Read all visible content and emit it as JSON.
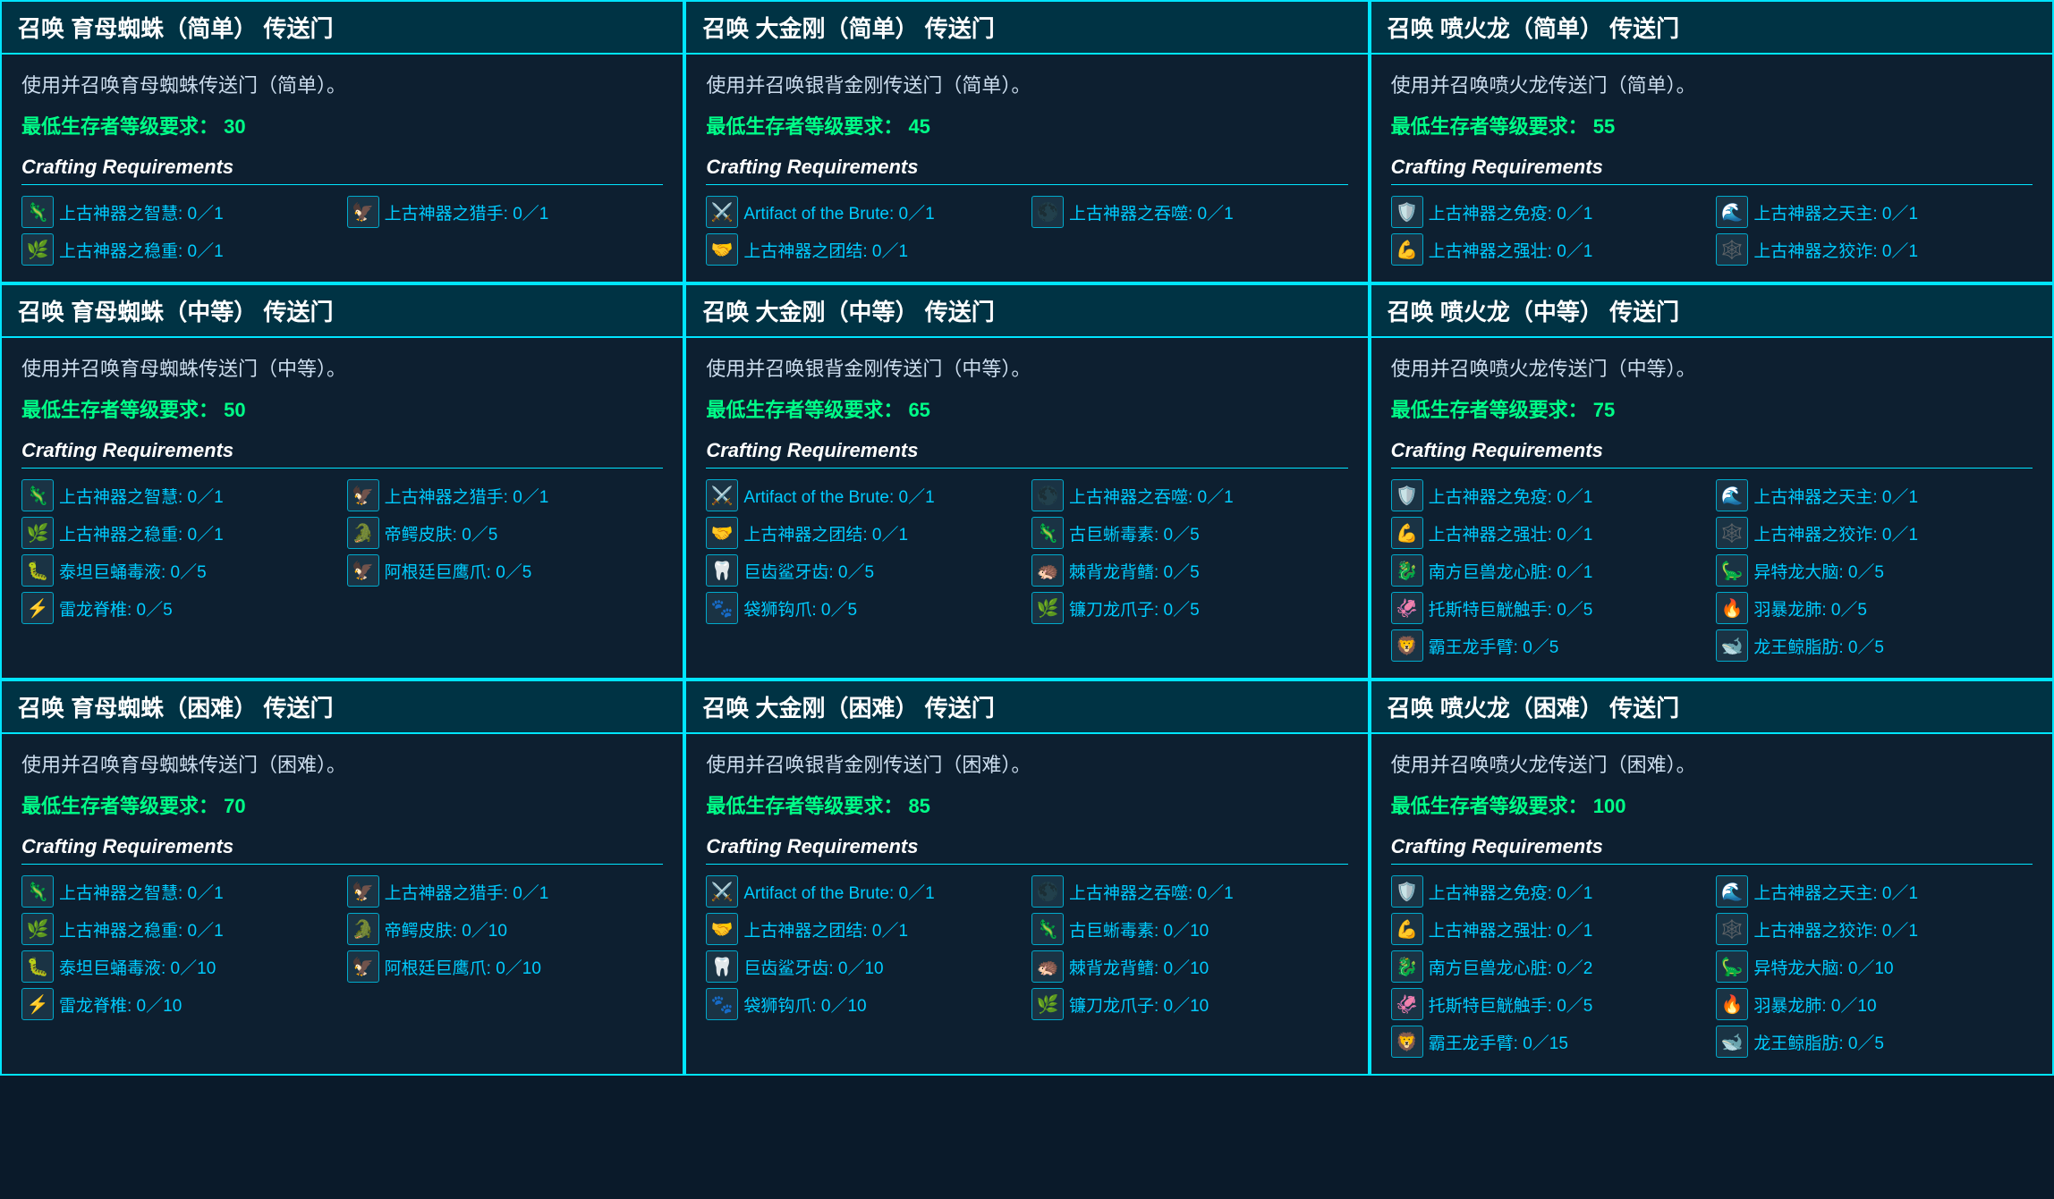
{
  "cards": [
    {
      "id": "spider-easy",
      "header": "召唤 育母蜘蛛（简单） 传送门",
      "description": "使用并召唤育母蜘蛛传送门（简单）。",
      "level_label": "最低生存者等级要求：",
      "level_value": "30",
      "crafting_title": "Crafting Requirements",
      "requirements": [
        {
          "icon": "🦎",
          "icon_class": "icon-green",
          "text": "上古神器之智慧: 0／1"
        },
        {
          "icon": "🦅",
          "icon_class": "icon-gray",
          "text": "上古神器之猎手: 0／1"
        },
        {
          "icon": "🌿",
          "icon_class": "icon-green",
          "text": "上古神器之稳重: 0／1"
        }
      ]
    },
    {
      "id": "gorilla-easy",
      "header": "召唤 大金刚（简单） 传送门",
      "description": "使用并召唤银背金刚传送门（简单）。",
      "level_label": "最低生存者等级要求：",
      "level_value": "45",
      "crafting_title": "Crafting Requirements",
      "requirements": [
        {
          "icon": "⚔️",
          "icon_class": "icon-orange",
          "text": "Artifact of the Brute: 0／1"
        },
        {
          "icon": "🌑",
          "icon_class": "icon-purple",
          "text": "上古神器之吞噬: 0／1"
        },
        {
          "icon": "🤝",
          "icon_class": "icon-cyan",
          "text": "上古神器之团结: 0／1"
        }
      ]
    },
    {
      "id": "dragon-easy",
      "header": "召唤 喷火龙（简单） 传送门",
      "description": "使用并召唤喷火龙传送门（简单）。",
      "level_label": "最低生存者等级要求：",
      "level_value": "55",
      "crafting_title": "Crafting Requirements",
      "requirements": [
        {
          "icon": "🛡️",
          "icon_class": "icon-red",
          "text": "上古神器之免疫: 0／1"
        },
        {
          "icon": "🌊",
          "icon_class": "icon-blue",
          "text": "上古神器之天主: 0／1"
        },
        {
          "icon": "💪",
          "icon_class": "icon-yellow",
          "text": "上古神器之强壮: 0／1"
        },
        {
          "icon": "🕸️",
          "icon_class": "icon-purple",
          "text": "上古神器之狡诈: 0／1"
        }
      ]
    },
    {
      "id": "spider-medium",
      "header": "召唤 育母蜘蛛（中等） 传送门",
      "description": "使用并召唤育母蜘蛛传送门（中等）。",
      "level_label": "最低生存者等级要求：",
      "level_value": "50",
      "crafting_title": "Crafting Requirements",
      "requirements": [
        {
          "icon": "🦎",
          "icon_class": "icon-green",
          "text": "上古神器之智慧: 0／1"
        },
        {
          "icon": "🦅",
          "icon_class": "icon-gray",
          "text": "上古神器之猎手: 0／1"
        },
        {
          "icon": "🌿",
          "icon_class": "icon-green",
          "text": "上古神器之稳重: 0／1"
        },
        {
          "icon": "🐊",
          "icon_class": "icon-green",
          "text": "帝鳄皮肤: 0／5"
        },
        {
          "icon": "🐛",
          "icon_class": "icon-yellow",
          "text": "泰坦巨蛹毒液: 0／5"
        },
        {
          "icon": "🦅",
          "icon_class": "icon-cyan",
          "text": "阿根廷巨鹰爪: 0／5"
        },
        {
          "icon": "⚡",
          "icon_class": "icon-blue",
          "text": "雷龙脊椎: 0／5"
        }
      ]
    },
    {
      "id": "gorilla-medium",
      "header": "召唤 大金刚（中等） 传送门",
      "description": "使用并召唤银背金刚传送门（中等）。",
      "level_label": "最低生存者等级要求：",
      "level_value": "65",
      "crafting_title": "Crafting Requirements",
      "requirements": [
        {
          "icon": "⚔️",
          "icon_class": "icon-orange",
          "text": "Artifact of the Brute: 0／1"
        },
        {
          "icon": "🌑",
          "icon_class": "icon-purple",
          "text": "上古神器之吞噬: 0／1"
        },
        {
          "icon": "🤝",
          "icon_class": "icon-cyan",
          "text": "上古神器之团结: 0／1"
        },
        {
          "icon": "🦎",
          "icon_class": "icon-green",
          "text": "古巨蜥毒素: 0／5"
        },
        {
          "icon": "🦷",
          "icon_class": "icon-gray",
          "text": "巨齿鲨牙齿: 0／5"
        },
        {
          "icon": "🦔",
          "icon_class": "icon-red",
          "text": "棘背龙背鳍: 0／5"
        },
        {
          "icon": "🐾",
          "icon_class": "icon-gray",
          "text": "袋狮钩爪: 0／5"
        },
        {
          "icon": "🌿",
          "icon_class": "icon-green",
          "text": "镰刀龙爪子: 0／5"
        }
      ]
    },
    {
      "id": "dragon-medium",
      "header": "召唤 喷火龙（中等） 传送门",
      "description": "使用并召唤喷火龙传送门（中等）。",
      "level_label": "最低生存者等级要求：",
      "level_value": "75",
      "crafting_title": "Crafting Requirements",
      "requirements": [
        {
          "icon": "🛡️",
          "icon_class": "icon-red",
          "text": "上古神器之免疫: 0／1"
        },
        {
          "icon": "🌊",
          "icon_class": "icon-blue",
          "text": "上古神器之天主: 0／1"
        },
        {
          "icon": "💪",
          "icon_class": "icon-yellow",
          "text": "上古神器之强壮: 0／1"
        },
        {
          "icon": "🕸️",
          "icon_class": "icon-purple",
          "text": "上古神器之狡诈: 0／1"
        },
        {
          "icon": "🐉",
          "icon_class": "icon-red",
          "text": "南方巨兽龙心脏: 0／1"
        },
        {
          "icon": "🦕",
          "icon_class": "icon-cyan",
          "text": "异特龙大脑: 0／5"
        },
        {
          "icon": "🦑",
          "icon_class": "icon-blue",
          "text": "托斯特巨觥触手: 0／5"
        },
        {
          "icon": "🔥",
          "icon_class": "icon-red",
          "text": "羽暴龙肺: 0／5"
        },
        {
          "icon": "🦁",
          "icon_class": "icon-yellow",
          "text": "霸王龙手臂: 0／5"
        },
        {
          "icon": "🐋",
          "icon_class": "icon-blue",
          "text": "龙王鲸脂肪: 0／5"
        }
      ]
    },
    {
      "id": "spider-hard",
      "header": "召唤 育母蜘蛛（困难） 传送门",
      "description": "使用并召唤育母蜘蛛传送门（困难）。",
      "level_label": "最低生存者等级要求：",
      "level_value": "70",
      "crafting_title": "Crafting Requirements",
      "requirements": [
        {
          "icon": "🦎",
          "icon_class": "icon-green",
          "text": "上古神器之智慧: 0／1"
        },
        {
          "icon": "🦅",
          "icon_class": "icon-gray",
          "text": "上古神器之猎手: 0／1"
        },
        {
          "icon": "🌿",
          "icon_class": "icon-green",
          "text": "上古神器之稳重: 0／1"
        },
        {
          "icon": "🐊",
          "icon_class": "icon-green",
          "text": "帝鳄皮肤: 0／10"
        },
        {
          "icon": "🐛",
          "icon_class": "icon-yellow",
          "text": "泰坦巨蛹毒液: 0／10"
        },
        {
          "icon": "🦅",
          "icon_class": "icon-cyan",
          "text": "阿根廷巨鹰爪: 0／10"
        },
        {
          "icon": "⚡",
          "icon_class": "icon-blue",
          "text": "雷龙脊椎: 0／10"
        }
      ]
    },
    {
      "id": "gorilla-hard",
      "header": "召唤 大金刚（困难） 传送门",
      "description": "使用并召唤银背金刚传送门（困难）。",
      "level_label": "最低生存者等级要求：",
      "level_value": "85",
      "crafting_title": "Crafting Requirements",
      "requirements": [
        {
          "icon": "⚔️",
          "icon_class": "icon-orange",
          "text": "Artifact of the Brute: 0／1"
        },
        {
          "icon": "🌑",
          "icon_class": "icon-purple",
          "text": "上古神器之吞噬: 0／1"
        },
        {
          "icon": "🤝",
          "icon_class": "icon-cyan",
          "text": "上古神器之团结: 0／1"
        },
        {
          "icon": "🦎",
          "icon_class": "icon-green",
          "text": "古巨蜥毒素: 0／10"
        },
        {
          "icon": "🦷",
          "icon_class": "icon-gray",
          "text": "巨齿鲨牙齿: 0／10"
        },
        {
          "icon": "🦔",
          "icon_class": "icon-red",
          "text": "棘背龙背鳍: 0／10"
        },
        {
          "icon": "🐾",
          "icon_class": "icon-gray",
          "text": "袋狮钩爪: 0／10"
        },
        {
          "icon": "🌿",
          "icon_class": "icon-green",
          "text": "镰刀龙爪子: 0／10"
        }
      ]
    },
    {
      "id": "dragon-hard",
      "header": "召唤 喷火龙（困难） 传送门",
      "description": "使用并召唤喷火龙传送门（困难）。",
      "level_label": "最低生存者等级要求：",
      "level_value": "100",
      "crafting_title": "Crafting Requirements",
      "requirements": [
        {
          "icon": "🛡️",
          "icon_class": "icon-red",
          "text": "上古神器之免疫: 0／1"
        },
        {
          "icon": "🌊",
          "icon_class": "icon-blue",
          "text": "上古神器之天主: 0／1"
        },
        {
          "icon": "💪",
          "icon_class": "icon-yellow",
          "text": "上古神器之强壮: 0／1"
        },
        {
          "icon": "🕸️",
          "icon_class": "icon-purple",
          "text": "上古神器之狡诈: 0／1"
        },
        {
          "icon": "🐉",
          "icon_class": "icon-red",
          "text": "南方巨兽龙心脏: 0／2"
        },
        {
          "icon": "🦕",
          "icon_class": "icon-cyan",
          "text": "异特龙大脑: 0／10"
        },
        {
          "icon": "🦑",
          "icon_class": "icon-blue",
          "text": "托斯特巨觥触手: 0／5"
        },
        {
          "icon": "🔥",
          "icon_class": "icon-red",
          "text": "羽暴龙肺: 0／10"
        },
        {
          "icon": "🦁",
          "icon_class": "icon-yellow",
          "text": "霸王龙手臂: 0／15"
        },
        {
          "icon": "🐋",
          "icon_class": "icon-blue",
          "text": "龙王鲸脂肪: 0／5"
        }
      ]
    }
  ]
}
